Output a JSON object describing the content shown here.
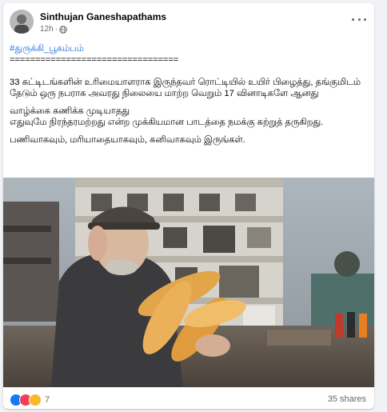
{
  "post": {
    "author": "Sinthujan Ganeshapathams",
    "time": "12h",
    "hashtag": "#துருக்கி_பூகம்பம்",
    "divider": "=================================",
    "paragraph1": "33 கட்டிடங்களின் உரிமையாளராக இருந்தவர் ரொட்டியில் உயிர் பிழைத்து, தங்குமிடம் தேடும் ஒரு நபராக அவரது நிலையை மாற்ற வெறும் 17 வினாடிகளே ஆனது",
    "paragraph2_line1": "வாழ்க்கை கணிக்க முடியாதது",
    "paragraph2_line2": "எதுவுமே நிரந்தரமற்றது என்ற முக்கியமான பாடத்தை நமக்கு கற்றுத் தருகிறது.",
    "paragraph3": " பணிவாகவும், மரியாதையாகவும், கனிவாகவும் இருங்கள்.",
    "reaction_count": "7",
    "shares": "35 shares",
    "reaction_icons": [
      "like-icon",
      "love-icon",
      "sad-icon"
    ]
  },
  "colors": {
    "hashtag": "#216fdb",
    "like": "#1877f2",
    "love": "#f33e58",
    "sad": "#f7b928"
  }
}
